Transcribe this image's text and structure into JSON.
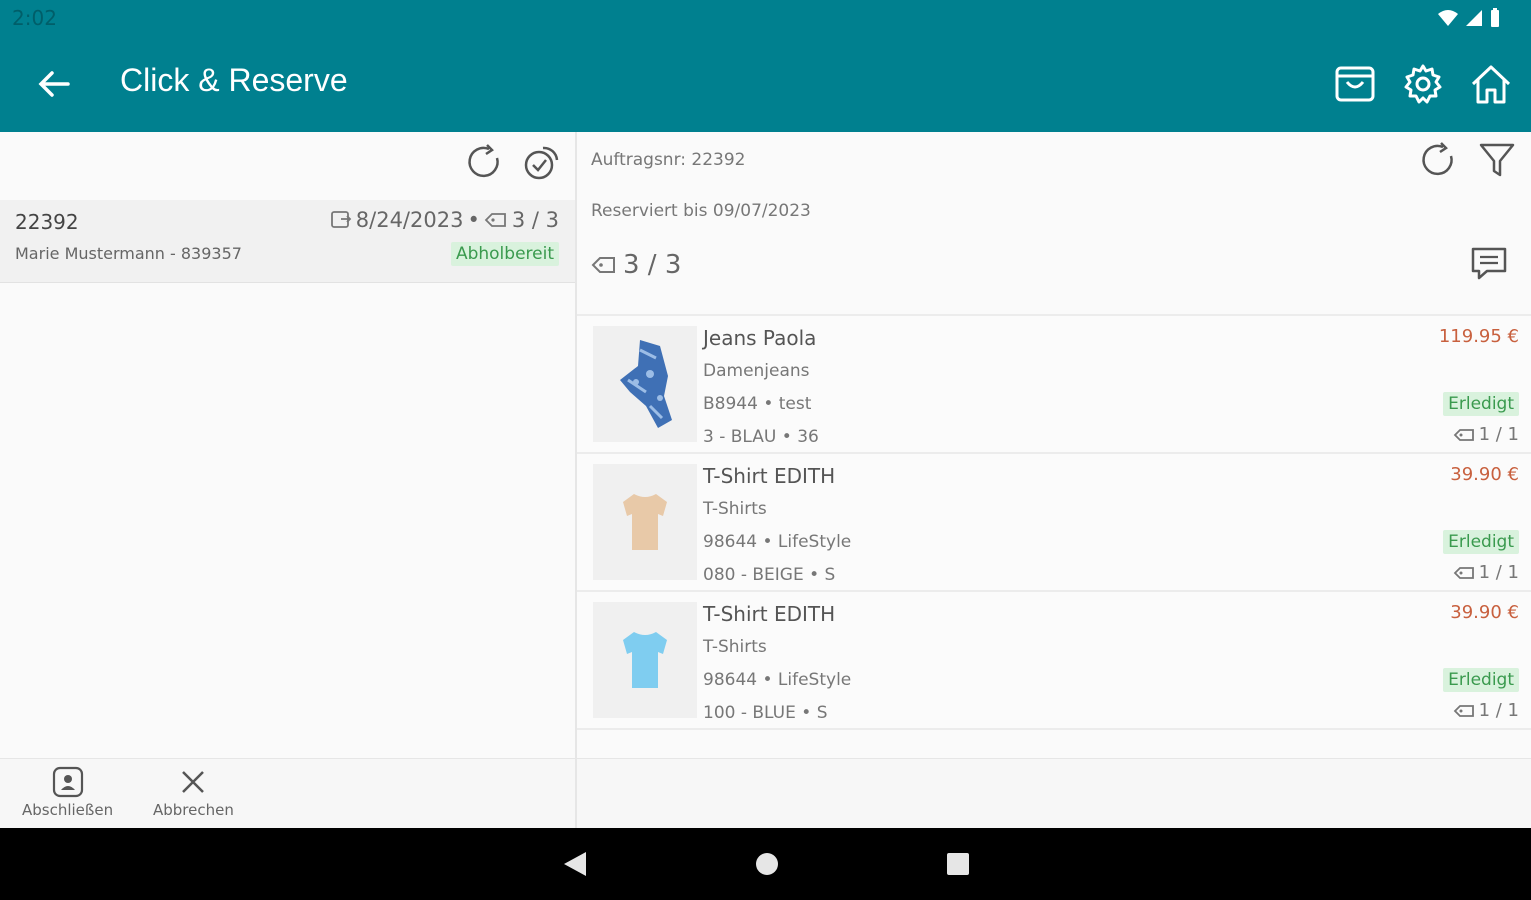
{
  "status_bar": {
    "time": "2:02"
  },
  "appbar": {
    "title": "Click & Reserve"
  },
  "order_list": {
    "items": [
      {
        "id": "22392",
        "customer": "Marie Mustermann - 839357",
        "date": "8/24/2023",
        "count": "3 / 3",
        "status": "Abholbereit"
      }
    ]
  },
  "detail": {
    "order_no": "Auftragsnr: 22392",
    "reserved_until": "Reserviert bis  09/07/2023",
    "count": "3 / 3",
    "items": [
      {
        "name": "Jeans Paola",
        "category": "Damenjeans",
        "code": "B8944 • test",
        "variant": "3 - BLAU • 36",
        "price": "119.95 €",
        "status": "Erledigt",
        "qty": "1 / 1"
      },
      {
        "name": "T-Shirt EDITH",
        "category": "T-Shirts",
        "code": "98644 • LifeStyle",
        "variant": "080 - BEIGE • S",
        "price": "39.90 €",
        "status": "Erledigt",
        "qty": "1 / 1"
      },
      {
        "name": "T-Shirt EDITH",
        "category": "T-Shirts",
        "code": "98644 • LifeStyle",
        "variant": "100 - BLUE • S",
        "price": "39.90 €",
        "status": "Erledigt",
        "qty": "1 / 1"
      }
    ]
  },
  "actions": {
    "complete": "Abschließen",
    "cancel": "Abbrechen"
  },
  "colors": {
    "primary": "#00808f",
    "price": "#c8603e",
    "badge_bg": "#d9f2dd",
    "badge_text": "#3a9a4e"
  },
  "icons": [
    "back-arrow-icon",
    "basket-icon",
    "gear-icon",
    "home-icon",
    "refresh-icon",
    "check-all-icon",
    "filter-icon",
    "comment-icon",
    "tag-icon",
    "calendar-icon",
    "clipboard-person-icon",
    "close-icon"
  ]
}
